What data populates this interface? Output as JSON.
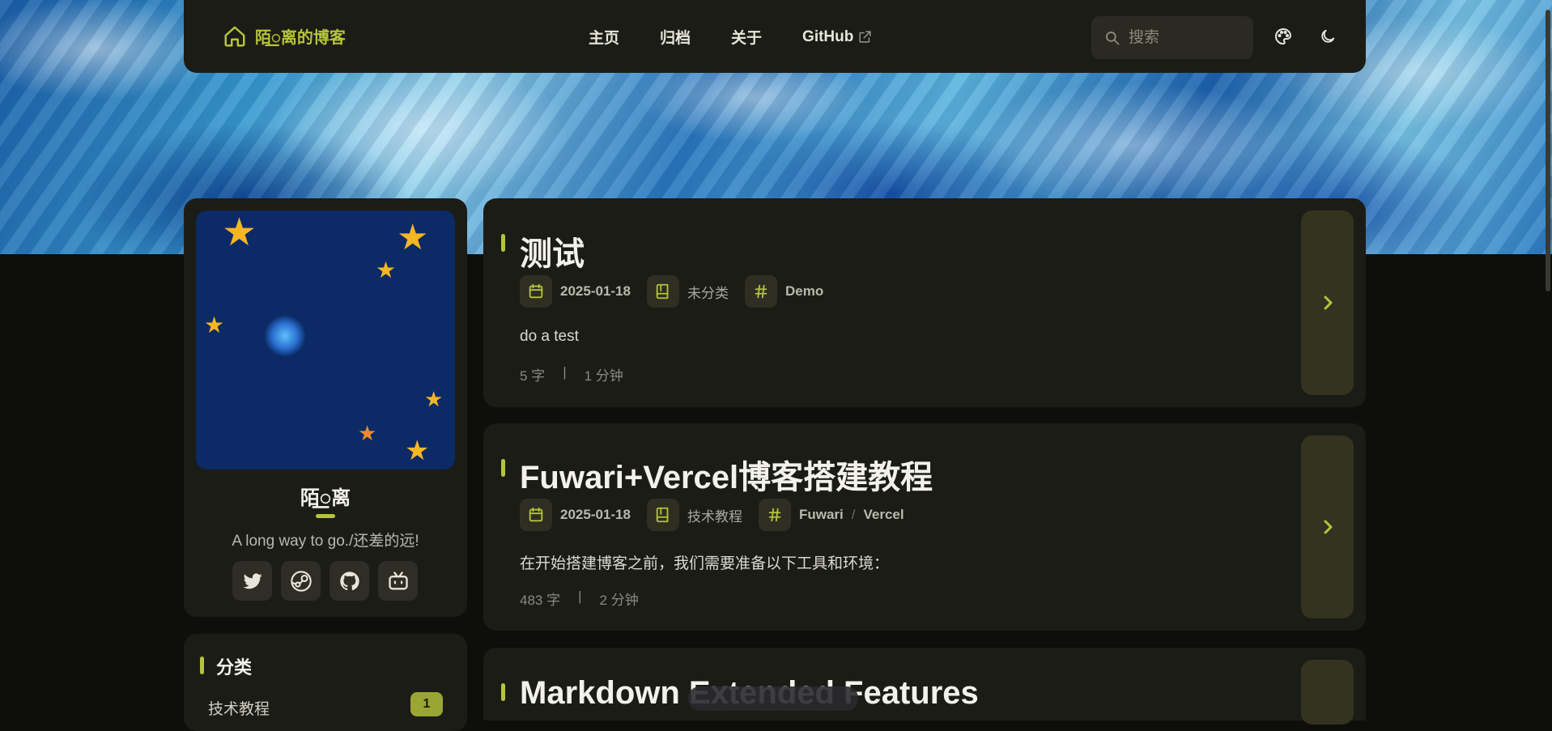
{
  "header": {
    "brand": "陌꯭离的博客",
    "nav": [
      "主页",
      "归档",
      "关于",
      "GitHub"
    ],
    "search_placeholder": "搜索"
  },
  "profile": {
    "name": "陌꯭离",
    "bio": "A long way to go./还差的远!",
    "socials": [
      "twitter-icon",
      "steam-icon",
      "github-icon",
      "bilibili-icon"
    ]
  },
  "categories": {
    "title": "分类",
    "items": [
      {
        "label": "技术教程",
        "count": "1"
      }
    ]
  },
  "posts": [
    {
      "title": "测试",
      "date": "2025-01-18",
      "category": "未分类",
      "tags": [
        "Demo"
      ],
      "excerpt": "do a test",
      "words": "5 字",
      "read_time": "1 分钟"
    },
    {
      "title": "Fuwari+Vercel博客搭建教程",
      "date": "2025-01-18",
      "category": "技术教程",
      "tags": [
        "Fuwari",
        "Vercel"
      ],
      "excerpt": "在开始搭建博客之前，我们需要准备以下工具和环境：",
      "words": "483 字",
      "read_time": "2 分钟"
    },
    {
      "title": "Markdown Extended Features"
    }
  ],
  "colors": {
    "accent": "#b5c43a",
    "card_bg": "#1c1c16",
    "page_bg": "#0e0e0a"
  }
}
